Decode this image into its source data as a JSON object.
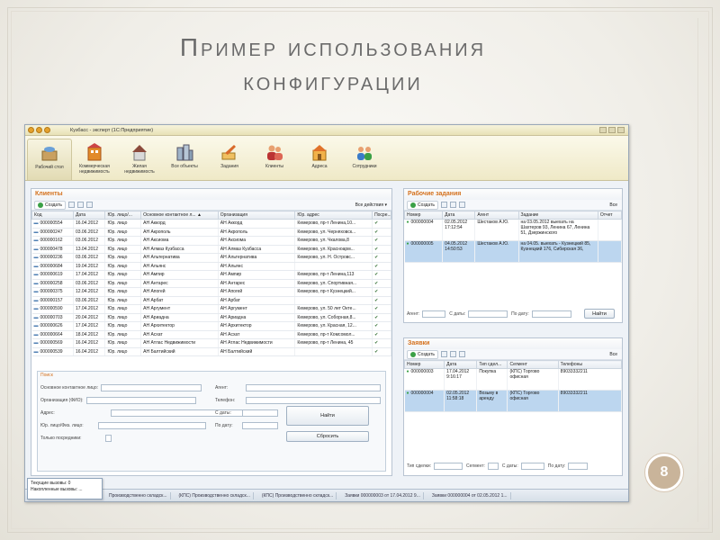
{
  "slide": {
    "title_line1": "Пример использования",
    "title_line2": "конфигурации",
    "page_number": "8"
  },
  "window": {
    "title": "Кузбасс - эксперт (1С:Предприятие)"
  },
  "toolbar": {
    "items": [
      {
        "label": "Рабочий стол",
        "icon": "desktop-icon"
      },
      {
        "label": "Коммерческая недвижимость",
        "icon": "commercial-building-icon"
      },
      {
        "label": "Жилая недвижимость",
        "icon": "house-icon"
      },
      {
        "label": "Все объекты",
        "icon": "buildings-icon"
      },
      {
        "label": "Задания",
        "icon": "tasks-icon"
      },
      {
        "label": "Клиенты",
        "icon": "clients-icon"
      },
      {
        "label": "Адреса",
        "icon": "address-icon"
      },
      {
        "label": "Сотрудники",
        "icon": "employees-icon"
      }
    ]
  },
  "clients": {
    "title": "Клиенты",
    "create_label": "Создать",
    "all_actions": "Все действия ▾",
    "columns": [
      "Код",
      "Дата",
      "Юр. лицо/...",
      "Основное контактное л... ▲",
      "Организация",
      "Юр. адрес",
      "Посре..."
    ],
    "rows": [
      [
        "000000554",
        "16.04.2012",
        "Юр. лицо",
        "АН Аккорд",
        "АН Аккорд",
        "Кемерово, пр-т Ленина,10...",
        "✔"
      ],
      [
        "000000247",
        "03.06.2012",
        "Юр. лицо",
        "АН Акрополь",
        "АН Акрополь",
        "Кемерово, ул. Черняховск...",
        "✔"
      ],
      [
        "000000162",
        "03.06.2012",
        "Юр. лицо",
        "АН Аксиома",
        "АН Аксиома",
        "Кемерово, ул. Чкалова,8",
        "✔"
      ],
      [
        "000000478",
        "13.04.2012",
        "Юр. лицо",
        "АН Алмаз Кузбасса",
        "АН Алмаз Кузбасса",
        "Кемерово, ул. Красноарм...",
        "✔"
      ],
      [
        "000000236",
        "03.06.2012",
        "Юр. лицо",
        "АН Альтернатива",
        "АН Альтернатива",
        "Кемерово, ул. Н. Островс...",
        "✔"
      ],
      [
        "000000684",
        "19.04.2012",
        "Юр. лицо",
        "АН Альянс",
        "АН Альянс",
        "",
        "✔"
      ],
      [
        "000000619",
        "17.04.2012",
        "Юр. лицо",
        "АН Ампир",
        "АН Ампир",
        "Кемерово, пр-т Ленина,113",
        "✔"
      ],
      [
        "000000258",
        "03.06.2012",
        "Юр. лицо",
        "АН Антарес",
        "АН Антарес",
        "Кемерово, ул. Спортивная...",
        "✔"
      ],
      [
        "000000375",
        "12.04.2012",
        "Юр. лицо",
        "АН Апогей",
        "АН Апогей",
        "Кемерово, пр-т Кузнецкий...",
        "✔"
      ],
      [
        "000000157",
        "03.06.2012",
        "Юр. лицо",
        "АН Арбат",
        "АН Арбат",
        "",
        "✔"
      ],
      [
        "000000590",
        "17.04.2012",
        "Юр. лицо",
        "АН Аргумент",
        "АН Аргумент",
        "Кемерово, ул. 50 лет Окте...",
        "✔"
      ],
      [
        "000000703",
        "20.04.2012",
        "Юр. лицо",
        "АН Ариадна",
        "АН Ариадна",
        "Кемерово, ул. Соборная,8...",
        "✔"
      ],
      [
        "000000626",
        "17.04.2012",
        "Юр. лицо",
        "АН Архитектор",
        "АН Архитектор",
        "Кемерово, ул. Красная, 12...",
        "✔"
      ],
      [
        "000000664",
        "18.04.2012",
        "Юр. лицо",
        "АН Асхат",
        "АН Асхат",
        "Кемерово, пр-т Комсомол...",
        "✔"
      ],
      [
        "000000569",
        "16.04.2012",
        "Юр. лицо",
        "АН Атлас Недвижимости",
        "АН Атлас Недвижимости",
        "Кемерово, пр-т Ленина, 45",
        "✔"
      ],
      [
        "000000539",
        "16.04.2012",
        "Юр. лицо",
        "АН Балтийский",
        "АН Балтийский",
        "",
        "✔"
      ]
    ]
  },
  "search": {
    "title": "Поиск",
    "contact_label": "Основное контактное лицо:",
    "org_label": "Организация (ФИО):",
    "address_label": "Адрес:",
    "jur_label": "Юр. лицо/Физ. лицо:",
    "only_intermediaries_label": "Только посредники:",
    "agent_label": "Агент:",
    "phone_label": "Телефон:",
    "from_date_label": "С даты:",
    "to_date_label": "По дату:",
    "find_button": "Найти",
    "reset_button": "Сбросить"
  },
  "tasks": {
    "title": "Рабочие задания",
    "create_label": "Создать",
    "all_label": "Все",
    "columns": [
      "Номер",
      "Дата",
      "Агент",
      "Задание",
      "Отчет"
    ],
    "rows": [
      [
        "000000004",
        "02.05.2012 17:12:54",
        "Шестаков А.Ю.",
        "на 03.05.2012 выехать на Шахтеров 93, Ленина 67, Ленина 51, Дзержинского",
        ""
      ],
      [
        "000000005",
        "04.05.2012 14:50:53",
        "Шестаков А.Ю.",
        "на 04.05. выехать - Кузнецкий 85, Кузнецкий 176, Сибирская 36,",
        ""
      ]
    ],
    "agent_label": "Агент:",
    "from_date_label": "С даты:",
    "to_date_label": "По дату:",
    "find_button": "Найти"
  },
  "requests": {
    "title": "Заявки",
    "create_label": "Создать",
    "all_label": "Все",
    "columns": [
      "Номер",
      "Дата",
      "Тип сдел...",
      "Сегмент",
      "Телефоны"
    ],
    "rows": [
      [
        "000000003",
        "17.04.2012 9:16:17",
        "Покупка",
        "(КПС) Торгово офисная",
        "89033332211"
      ],
      [
        "000000004",
        "02.05.2012 11:58:18",
        "Возьму в аренду",
        "(КПС) Торгово офисная",
        "89033332211"
      ]
    ],
    "deal_type_label": "Тип сделки:",
    "segment_label": "Сегмент:",
    "from_date_label": "С даты:",
    "to_date_label": "По дату:"
  },
  "status": {
    "calls_current": "Текущие вызовы: 0",
    "calls_accumulated": "Накопленные вызовы: ...",
    "tasks": [
      "Производственно складск...",
      "(КПС) Производственно складск...",
      "(КПС) Производственно складск...",
      "Заявки 000000003 от 17.04.2012 9...",
      "Заявки 000000004 от 02.05.2012 1..."
    ]
  },
  "colors": {
    "accent_orange": "#d4711d",
    "selection_blue": "#bcd6ef",
    "badge": "#c9b49a"
  }
}
